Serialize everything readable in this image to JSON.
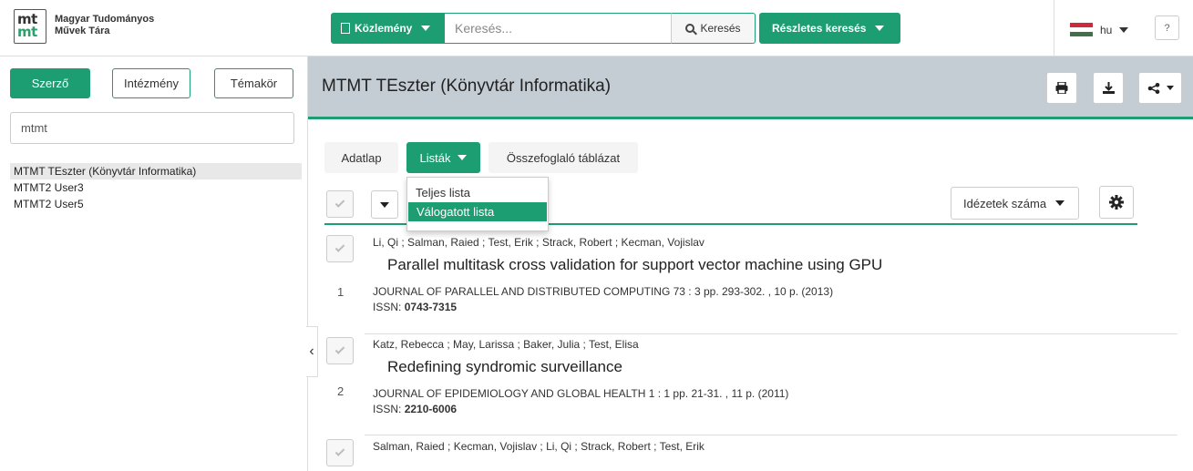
{
  "logo": {
    "mark_top": "mt",
    "mark_bottom": "mt",
    "line1": "Magyar Tudományos",
    "line2": "Művek Tára"
  },
  "search": {
    "type_label": "Közlemény",
    "placeholder": "Keresés...",
    "search_label": "Keresés",
    "advanced_label": "Részletes keresés"
  },
  "lang": {
    "code": "hu",
    "flag_colors": [
      "#cd2a3e",
      "#ffffff",
      "#436f4d"
    ]
  },
  "help_label": "?",
  "sidebar": {
    "tabs": [
      "Szerző",
      "Intézmény",
      "Témakör"
    ],
    "filter_value": "mtmt",
    "items": [
      "MTMT TEszter (Könyvtár Informatika)",
      "MTMT2 User3",
      "MTMT2 User5"
    ]
  },
  "main": {
    "title": "MTMT TEszter (Könyvtár Informatika)",
    "subtabs": [
      "Adatlap",
      "Listák",
      "Összefoglaló táblázat"
    ],
    "dropdown": [
      "Teljes lista",
      "Válogatott lista"
    ],
    "sort_label": "Idézetek száma"
  },
  "publications": [
    {
      "num": "1",
      "authors": "Li, Qi ; Salman, Raied ; Test, Erik ; Strack, Robert ; Kecman, Vojislav",
      "title": "Parallel multitask cross validation for support vector machine using GPU",
      "journal": "JOURNAL OF PARALLEL AND DISTRIBUTED COMPUTING 73 : 3 pp. 293-302. , 10 p. (2013)",
      "issn_label": "ISSN:",
      "issn": "0743-7315"
    },
    {
      "num": "2",
      "authors": "Katz, Rebecca ; May, Larissa ; Baker, Julia ; Test, Elisa",
      "title": "Redefining syndromic surveillance",
      "journal": "JOURNAL OF EPIDEMIOLOGY AND GLOBAL HEALTH 1 : 1 pp. 21-31. , 11 p. (2011)",
      "issn_label": "ISSN:",
      "issn": "2210-6006"
    },
    {
      "authors": "Salman, Raied ; Kecman, Vojislav ; Li, Qi ; Strack, Robert ; Test, Erik"
    }
  ],
  "colors": {
    "accent": "#1d9e72",
    "header_bg": "#c4ccd4"
  }
}
